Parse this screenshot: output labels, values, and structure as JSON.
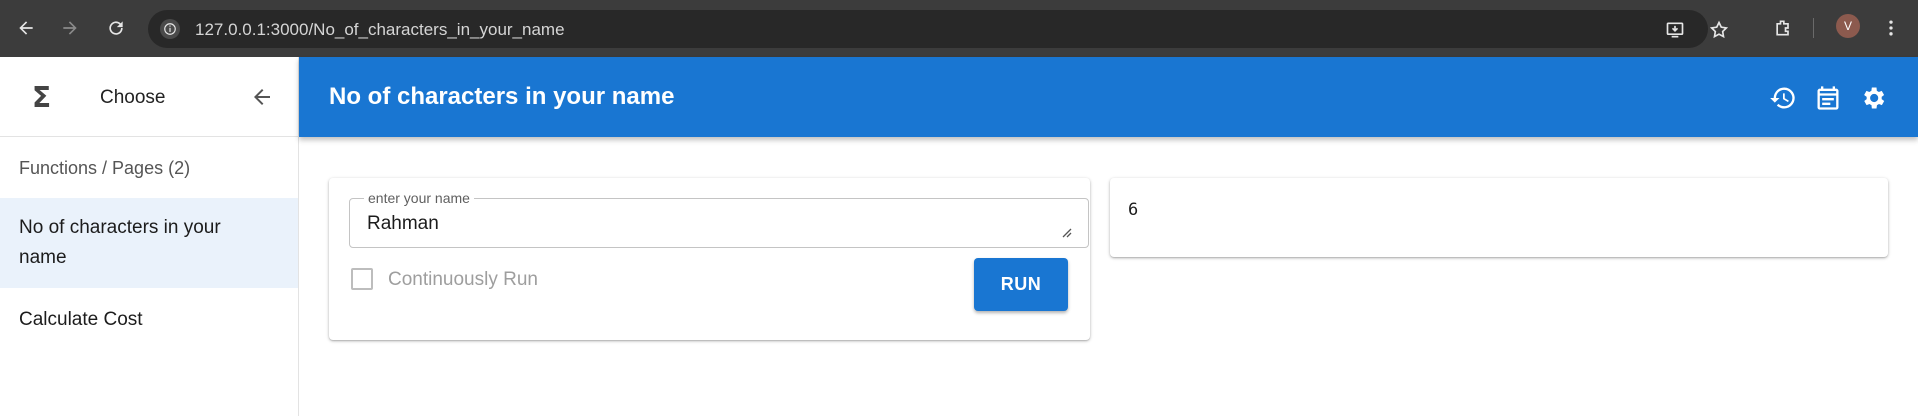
{
  "browser": {
    "url": "127.0.0.1:3000/No_of_characters_in_your_name",
    "profile_initial": "V"
  },
  "sidebar": {
    "logo_glyph": "Σ",
    "header_title": "Choose",
    "section_title": "Functions / Pages (2)",
    "items": [
      {
        "label": "No of characters in your name",
        "active": true
      },
      {
        "label": "Calculate Cost",
        "active": false
      }
    ]
  },
  "appbar": {
    "title": "No of characters in your name",
    "accent_color": "#1976d2"
  },
  "form": {
    "field_label": "enter your name",
    "field_value": "Rahman",
    "checkbox_label": "Continuously Run",
    "checkbox_checked": false,
    "run_label": "RUN"
  },
  "result": {
    "value": "6"
  }
}
